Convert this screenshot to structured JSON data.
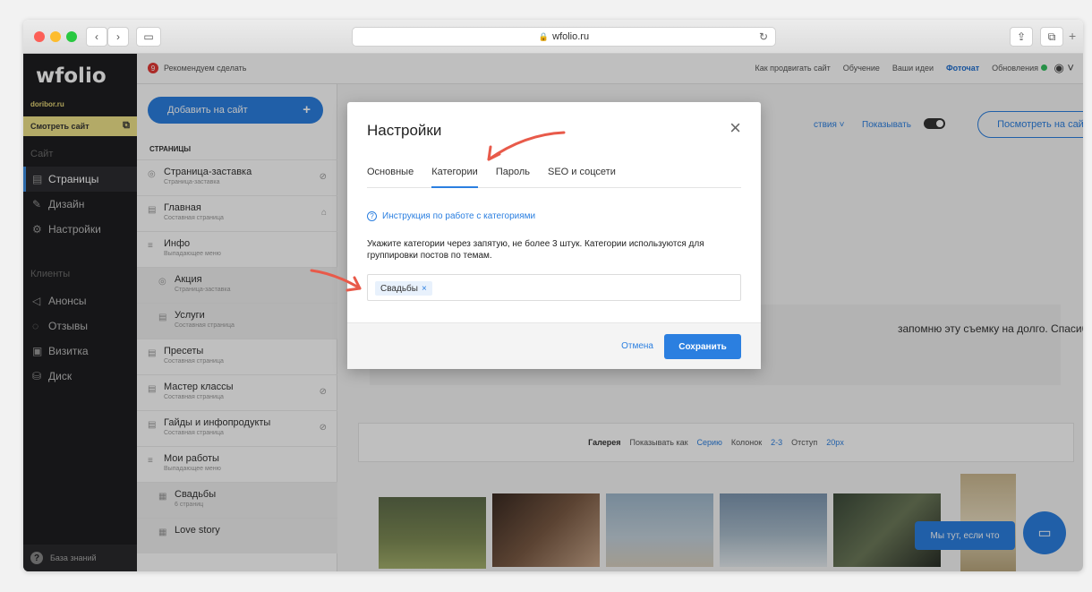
{
  "browser": {
    "url": "wfolio.ru"
  },
  "sidebar": {
    "logo": "wfolio",
    "domain": "doribor.ru",
    "view_site": "Смотреть сайт",
    "section_site": "Сайт",
    "section_clients": "Клиенты",
    "items": [
      {
        "label": "Страницы",
        "icon": "page-icon"
      },
      {
        "label": "Дизайн",
        "icon": "brush-icon"
      },
      {
        "label": "Настройки",
        "icon": "gear-icon"
      },
      {
        "label": "Анонсы",
        "icon": "megaphone-icon"
      },
      {
        "label": "Отзывы",
        "icon": "chat-icon"
      },
      {
        "label": "Визитка",
        "icon": "card-icon"
      },
      {
        "label": "Диск",
        "icon": "disk-icon"
      }
    ],
    "knowledge_base": "База знаний"
  },
  "topbar": {
    "recommend": "Рекомендуем сделать",
    "badge": "9",
    "links": [
      "Как продвигать сайт",
      "Обучение",
      "Ваши идеи",
      "Фоточат",
      "Обновления"
    ]
  },
  "pages_panel": {
    "add_button": "Добавить на сайт",
    "title": "СТРАНИЦЫ",
    "items": [
      {
        "title": "Страница-заставка",
        "sub": "Страница-заставка"
      },
      {
        "title": "Главная",
        "sub": "Составная страница"
      },
      {
        "title": "Инфо",
        "sub": "Выпадающее меню"
      },
      {
        "title": "Акция",
        "sub": "Страница-заставка"
      },
      {
        "title": "Услуги",
        "sub": "Составная страница"
      },
      {
        "title": "Пресеты",
        "sub": "Составная страница"
      },
      {
        "title": "Мастер классы",
        "sub": "Составная страница"
      },
      {
        "title": "Гайды и инфопродукты",
        "sub": "Составная страница"
      },
      {
        "title": "Мои работы",
        "sub": "Выпадающее меню"
      },
      {
        "title": "Свадьбы",
        "sub": "6 страниц"
      },
      {
        "title": "Love story",
        "sub": ""
      }
    ]
  },
  "editor": {
    "actions": "ствия",
    "show": "Показывать",
    "view_live": "Посмотреть на сайте",
    "text_snippet": "запомню эту съемку на долго. Спасибо вам",
    "gallery": {
      "label": "Галерея",
      "show_as": "Показывать как",
      "show_as_value": "Серию",
      "columns": "Колонок",
      "columns_value": "2-3",
      "indent": "Отступ",
      "indent_value": "20px"
    },
    "chat_bubble": "Мы тут, если что"
  },
  "modal": {
    "title": "Настройки",
    "tabs": [
      "Основные",
      "Категории",
      "Пароль",
      "SEO и соцсети"
    ],
    "active_tab": "Категории",
    "help_link": "Инструкция по работе с категориями",
    "description": "Укажите категории через запятую, не более 3 штук. Категории используются для группировки постов по темам.",
    "tags": [
      "Свадьбы"
    ],
    "cancel": "Отмена",
    "save": "Сохранить"
  },
  "colors": {
    "accent": "#2b7fe0",
    "sidebar_bg": "#1e1e20",
    "highlight": "#efe38a",
    "arrow": "#e85a4a"
  }
}
